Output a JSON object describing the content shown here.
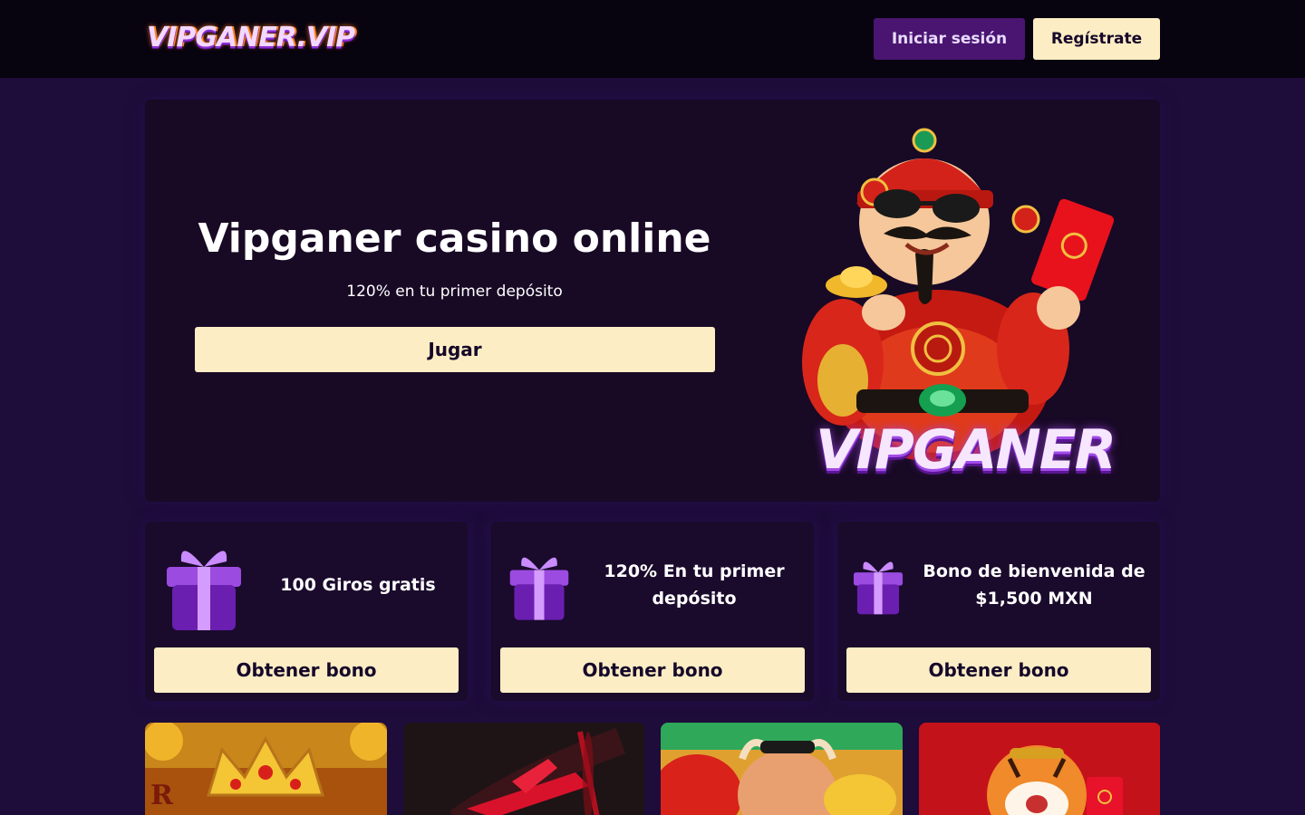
{
  "header": {
    "logo_text": "VIPGANER.VIP",
    "login_label": "Iniciar sesión",
    "register_label": "Regístrate"
  },
  "hero": {
    "title": "Vipganer casino online",
    "subtitle": "120% en tu primer depósito",
    "play_label": "Jugar",
    "brand_text": "VIPGANER"
  },
  "bonuses": [
    {
      "title": "100 Giros gratis",
      "button_label": "Obtener bono",
      "icon": "gift-icon"
    },
    {
      "title": "120% En tu primer depósito",
      "button_label": "Obtener bono",
      "icon": "gift-icon"
    },
    {
      "title": "Bono de bienvenida de $1,500 MXN",
      "button_label": "Obtener bono",
      "icon": "gift-icon"
    }
  ],
  "games": [
    {
      "icon": "golden-crown-game-thumbnail"
    },
    {
      "icon": "red-plane-game-thumbnail"
    },
    {
      "icon": "ox-fortune-game-thumbnail"
    },
    {
      "icon": "tiger-fortune-game-thumbnail"
    }
  ],
  "colors": {
    "page_bg": "#1e0c3a",
    "header_bg": "#07030f",
    "card_bg": "#1a0a2c",
    "cta_bg": "#fdedc4",
    "login_bg": "#4a1570"
  }
}
